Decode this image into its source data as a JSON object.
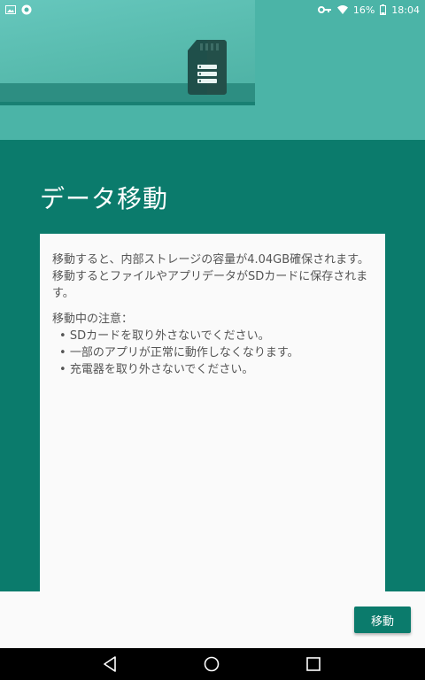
{
  "status_bar": {
    "battery_percent": "16%",
    "time": "18:04",
    "left_icons": [
      "gallery-icon",
      "notification-app-icon"
    ],
    "right_icons": [
      "vpn-key-icon",
      "wifi-icon",
      "battery-icon"
    ]
  },
  "hero": {
    "illustration": "sd-card-icon"
  },
  "page": {
    "title": "データ移動"
  },
  "card": {
    "description": "移動すると、内部ストレージの容量が4.04GB確保されます。移動するとファイルやアプリデータがSDカードに保存されます。",
    "notes_title": "移動中の注意：",
    "notes": [
      "SDカードを取り外さないでください。",
      "一部のアプリが正常に動作しなくなります。",
      "充電器を取り外さないでください。"
    ]
  },
  "actions": {
    "move_label": "移動"
  },
  "nav_bar": {
    "buttons": [
      "back-icon",
      "home-icon",
      "recents-icon"
    ]
  },
  "colors": {
    "primary": "#0b7b6c",
    "hero_bg": "#4bb4a7",
    "card_bg": "#fafafa",
    "text": "#555555"
  }
}
